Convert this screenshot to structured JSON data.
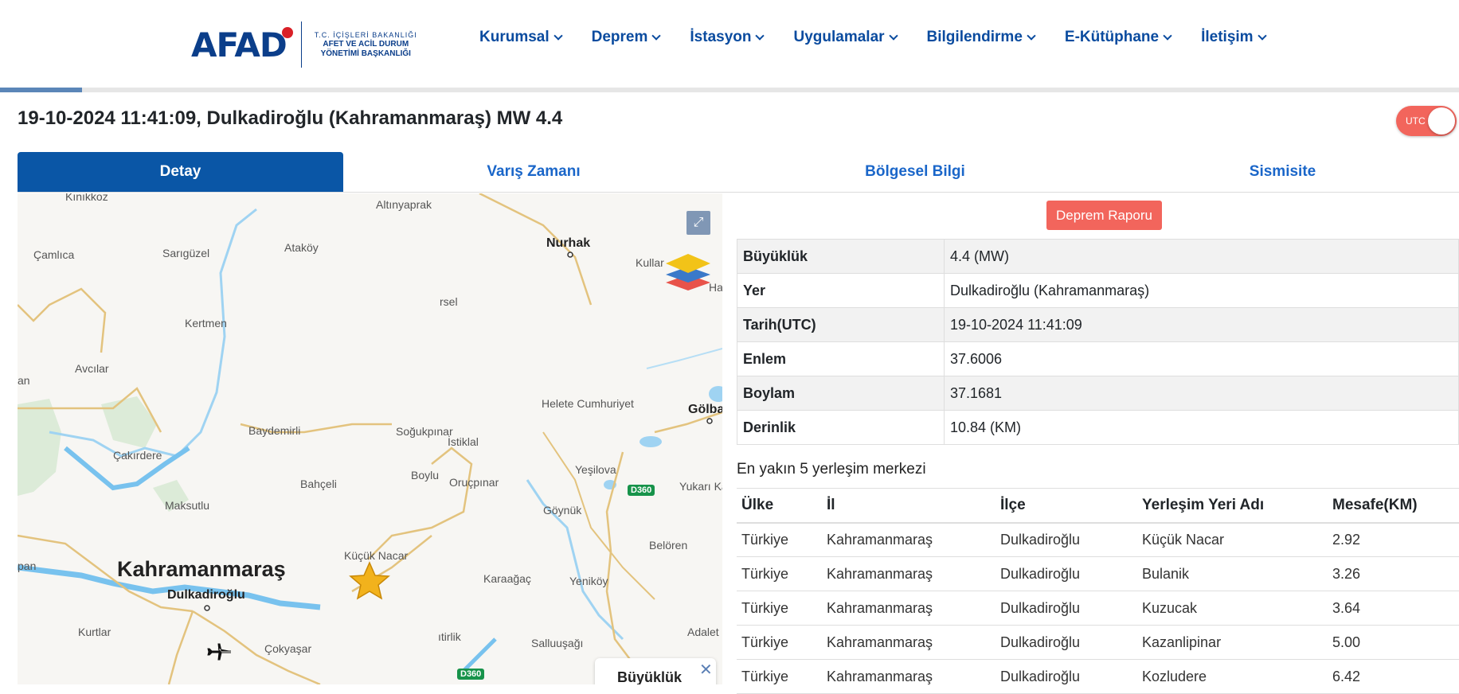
{
  "header": {
    "logo": {
      "word": "AFAD",
      "line1": "T.C. İÇİŞLERİ BAKANLIĞI",
      "line2": "AFET VE ACİL DURUM",
      "line3": "YÖNETİMİ BAŞKANLIĞI"
    },
    "nav": [
      "Kurumsal",
      "Deprem",
      "İstasyon",
      "Uygulamalar",
      "Bilgilendirme",
      "E-Kütüphane",
      "İletişim"
    ],
    "progress_fraction": 0.056
  },
  "event": {
    "title": "19-10-2024 11:41:09, Dulkadiroğlu (Kahramanmaraş) MW 4.4",
    "utc_toggle_label": "UTC"
  },
  "tabs": [
    "Detay",
    "Varış Zamanı",
    "Bölgesel Bilgi",
    "Sismisite"
  ],
  "map": {
    "places": [
      "Kınıkkoz",
      "Altınyaprak",
      "Çamlıca",
      "Sarıgüzel",
      "Ataköy",
      "Kullar",
      "rsel",
      "Kertmen",
      "an",
      "Avcılar",
      "Helete Cumhuriyet",
      "Baydemirli",
      "Soğukpınar",
      "İstiklal",
      "Çakırdere",
      "Boylu",
      "Oruçpınar",
      "Yeşilova",
      "Yukarı Ka",
      "Bahçeli",
      "Maksutlu",
      "Göynük",
      "Küçük Nacar",
      "Belören",
      "pan",
      "Karaağaç",
      "Yeniköy",
      "Kurtlar",
      "Çokyaşar",
      "ıtirlik",
      "Salluuşağı",
      "Adalet",
      "Ha"
    ],
    "cities": [
      "Nurhak",
      "Gölba",
      "Dulkadiroğlu"
    ],
    "big_city": "Kahramanmaraş",
    "road_badges": [
      "D360",
      "D360"
    ],
    "legend_title": "Büyüklük",
    "legend_close": "✕"
  },
  "report_button": "Deprem Raporu",
  "details": [
    {
      "key": "Büyüklük",
      "value": "4.4 (MW)"
    },
    {
      "key": "Yer",
      "value": "Dulkadiroğlu (Kahramanmaraş)"
    },
    {
      "key": "Tarih(UTC)",
      "value": "19-10-2024 11:41:09"
    },
    {
      "key": "Enlem",
      "value": "37.6006"
    },
    {
      "key": "Boylam",
      "value": "37.1681"
    },
    {
      "key": "Derinlik",
      "value": "10.84 (KM)"
    }
  ],
  "nearest": {
    "title": "En yakın 5 yerleşim merkezi",
    "headers": [
      "Ülke",
      "İl",
      "İlçe",
      "Yerleşim Yeri Adı",
      "Mesafe(KM)"
    ],
    "rows": [
      [
        "Türkiye",
        "Kahramanmaraş",
        "Dulkadiroğlu",
        "Küçük Nacar",
        "2.92"
      ],
      [
        "Türkiye",
        "Kahramanmaraş",
        "Dulkadiroğlu",
        "Bulanik",
        "3.26"
      ],
      [
        "Türkiye",
        "Kahramanmaraş",
        "Dulkadiroğlu",
        "Kuzucak",
        "3.64"
      ],
      [
        "Türkiye",
        "Kahramanmaraş",
        "Dulkadiroğlu",
        "Kazanlipinar",
        "5.00"
      ],
      [
        "Türkiye",
        "Kahramanmaraş",
        "Dulkadiroğlu",
        "Kozludere",
        "6.42"
      ]
    ]
  }
}
